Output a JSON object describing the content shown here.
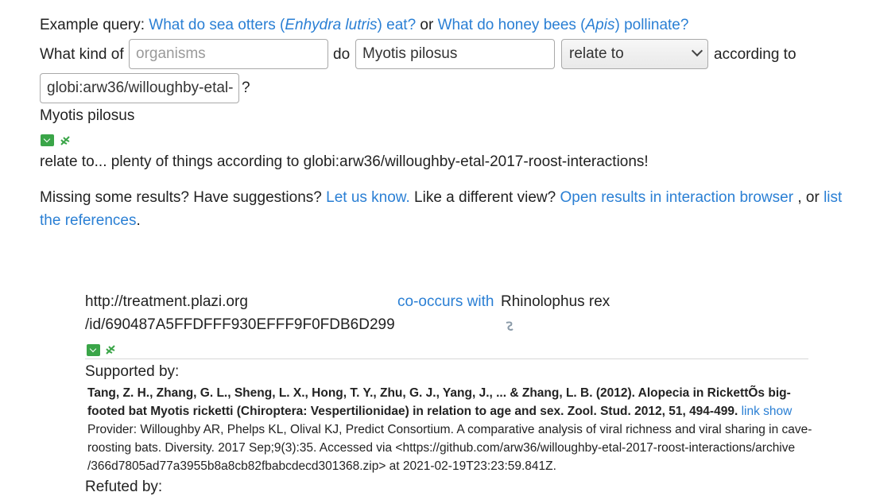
{
  "example": {
    "prefix": "Example query:",
    "q1_start": "What do sea otters (",
    "q1_species": "Enhydra lutris",
    "q1_end": ") eat?",
    "or": "or",
    "q2_start": "What do honey bees (",
    "q2_species": "Apis",
    "q2_end": ") pollinate?"
  },
  "query": {
    "what_kind_of": "What kind of",
    "organisms_placeholder": "organisms",
    "do": "do",
    "taxon_value": "Myotis pilosus",
    "relation_value": "relate to",
    "according_to": "according to",
    "source_value": "globi:arw36/willoughby-etal-",
    "question_mark": "?"
  },
  "result": {
    "taxon": "Myotis pilosus",
    "summary": "relate to... plenty of things according to globi:arw36/willoughby-etal-2017-roost-interactions!"
  },
  "feedback": {
    "missing": "Missing some results? Have suggestions?",
    "let_us_know": "Let us know.",
    "different_view": "Like a different view?",
    "open_browser": "Open results in interaction browser",
    "or": ", or",
    "list_the": "list",
    "references": "the references",
    "period": "."
  },
  "interaction": {
    "source_line1": "http://treatment.plazi.org",
    "source_line2": "/id/690487A5FFDFFF930EFFF9F0FDB6D299",
    "relation": "co-occurs with",
    "target": "Rhinolophus rex",
    "supported_by": "Supported by:",
    "citation_line1": "Tang, Z. H., Zhang, G. L., Sheng, L. X., Hong, T. Y., Zhu, G. J., Yang, J., ... & Zhang, L. B. (2012). Alopecia in RickettÕs big-",
    "citation_line2": "footed bat Myotis ricketti (Chiroptera: Vespertilionidae) in relation to age and sex. Zool. Stud. 2012, 51, 494-499.",
    "link": "link",
    "show": "show",
    "provider_line1": "Provider: Willoughby AR, Phelps KL, Olival KJ, Predict Consortium. A comparative analysis of viral richness and viral sharing in cave-",
    "provider_line2": "roosting bats. Diversity. 2017 Sep;9(3):35. Accessed via <https://github.com/arw36/willoughby-etal-2017-roost-interactions/archive",
    "provider_line3": "/366d7805ad77a3955b8a8cb82fbabcdecd301368.zip> at 2021-02-19T23:23:59.841Z.",
    "refuted_by": "Refuted by:"
  },
  "icons": {
    "expand": "expand-icon",
    "tree": "tree-icon",
    "loading": "loading-icon"
  },
  "colors": {
    "link": "#2a7fd4",
    "expand_green": "#3aa548"
  }
}
